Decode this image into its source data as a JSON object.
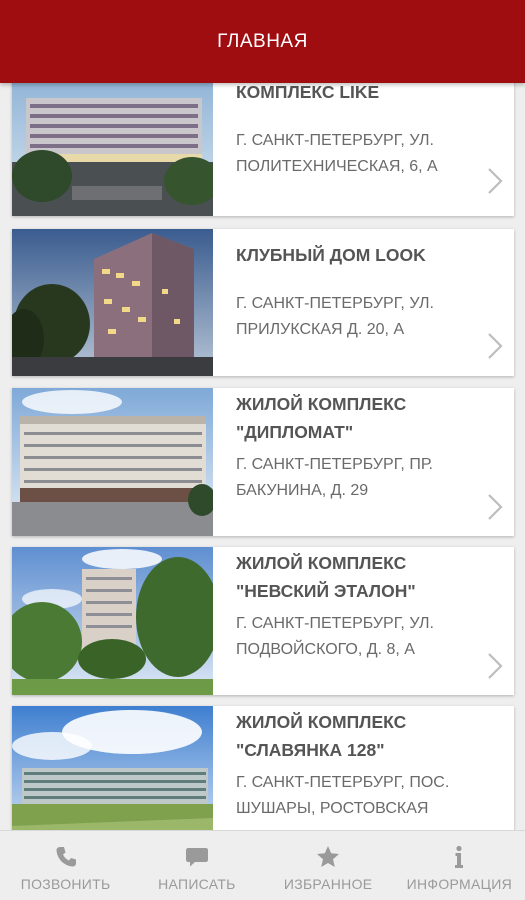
{
  "header": {
    "title": "ГЛАВНАЯ"
  },
  "listings": [
    {
      "title": "КОМПЛЕКС LIKE",
      "address": "Г. САНКТ-ПЕТЕРБУРГ, УЛ. ПОЛИТЕХНИЧЕСКАЯ, 6, А"
    },
    {
      "title": "КЛУБНЫЙ ДОМ LOOK",
      "address": "Г. САНКТ-ПЕТЕРБУРГ, УЛ. ПРИЛУКСКАЯ Д. 20, А"
    },
    {
      "title": "ЖИЛОЙ КОМПЛЕКС \"ДИПЛОМАТ\"",
      "address": "Г. САНКТ-ПЕТЕРБУРГ, ПР. БАКУНИНА, Д. 29"
    },
    {
      "title": "ЖИЛОЙ КОМПЛЕКС \"НЕВСКИЙ ЭТАЛОН\"",
      "address": "Г. САНКТ-ПЕТЕРБУРГ, УЛ. ПОДВОЙСКОГО, Д. 8, А"
    },
    {
      "title": "ЖИЛОЙ КОМПЛЕКС \"СЛАВЯНКА 128\"",
      "address": "Г. САНКТ-ПЕТЕРБУРГ, ПОС. ШУШАРЫ, РОСТОВСКАЯ"
    }
  ],
  "tabs": [
    {
      "label": "ПОЗВОНИТЬ",
      "icon": "phone-icon"
    },
    {
      "label": "НАПИСАТЬ",
      "icon": "chat-icon"
    },
    {
      "label": "ИЗБРАННОЕ",
      "icon": "star-icon"
    },
    {
      "label": "ИНФОРМАЦИЯ",
      "icon": "info-icon"
    }
  ],
  "colors": {
    "accent": "#a00d10",
    "tab_text": "#9a9a9a",
    "title_text": "#555555"
  }
}
